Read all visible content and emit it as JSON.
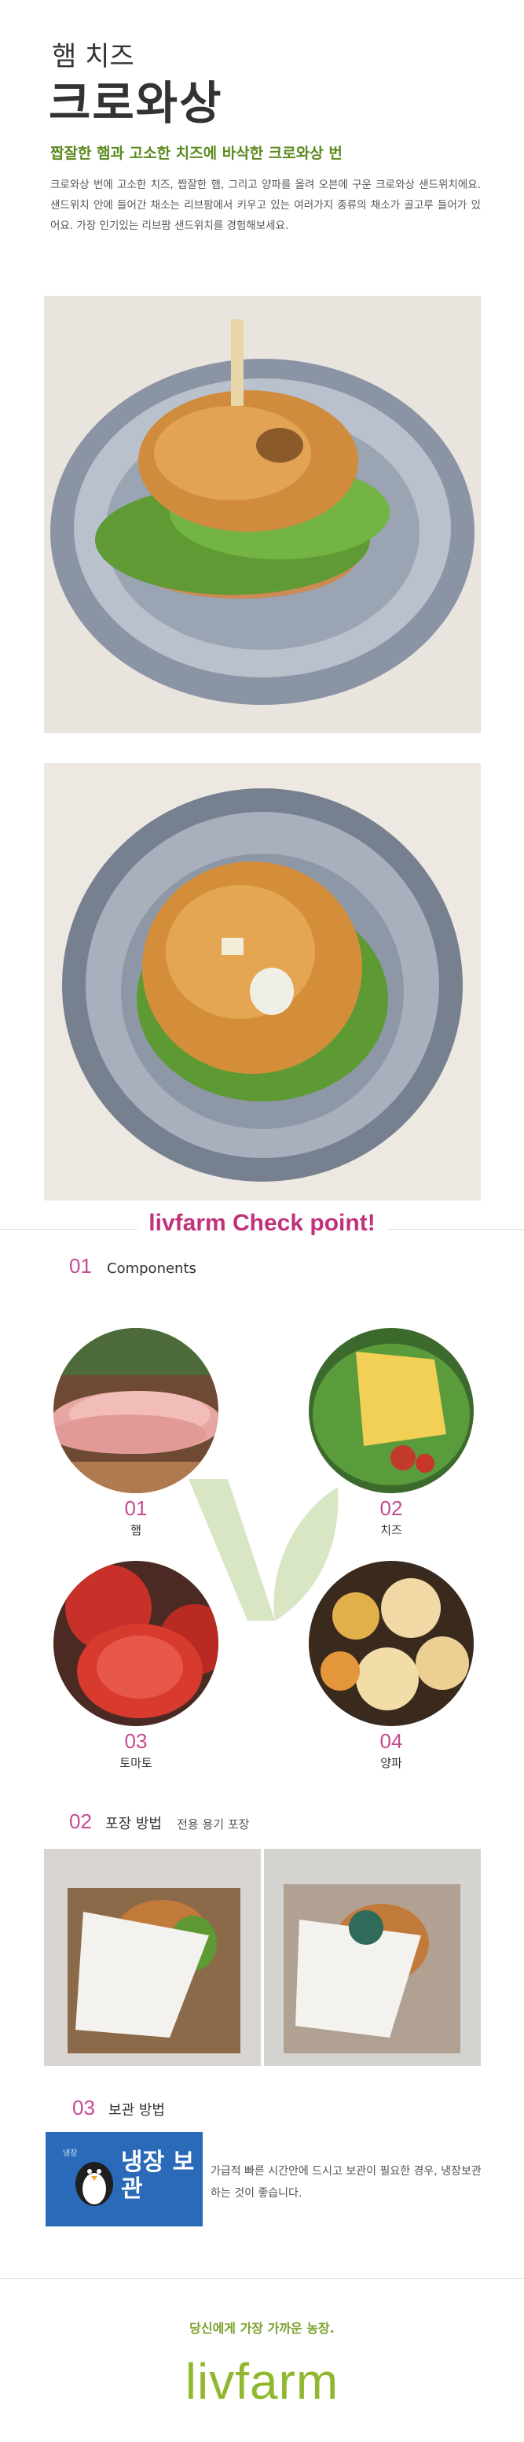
{
  "header": {
    "title_small": "햄 치즈",
    "title_large": "크로와상",
    "subtitle": "짭잘한 햄과 고소한 치즈에 바삭한 크로와상 번",
    "description": "크로와상 번에 고소한 치즈, 짭잘한 햄, 그리고 양파를 올려 오븐에 구운 크로와상 샌드위치에요. 샌드위치 안에 들어간 채소는 리브팜에서 키우고 있는 여러가지 종류의 채소가 골고루 들어가 있어요. 가장 인기있는 리브팜 샌드위치를 경험해보세요."
  },
  "checkpoint": {
    "title": "livfarm Check point!"
  },
  "sections": {
    "components": {
      "number": "01",
      "label": "Components"
    },
    "packaging": {
      "number": "02",
      "label": "포장 방법",
      "sub": "전용 용기 포장"
    },
    "storage": {
      "number": "03",
      "label": "보관 방법",
      "badge_small": "냉장",
      "badge_large": "냉장 보관",
      "text": "가급적 빠른 시간안에 드시고 보관이 필요한 경우, 냉장보관 하는 것이 좋습니다."
    }
  },
  "components": [
    {
      "number": "01",
      "name": "햄"
    },
    {
      "number": "02",
      "name": "치즈"
    },
    {
      "number": "03",
      "name": "토마토"
    },
    {
      "number": "04",
      "name": "양파"
    }
  ],
  "footer": {
    "tagline": "당신에게 가장 가까운 농장.",
    "brand": "livfarm"
  },
  "colors": {
    "accent_green": "#5d8a1e",
    "accent_pink": "#c64a93",
    "brand_green": "#8fb82e",
    "storage_blue": "#2a6ab8"
  }
}
